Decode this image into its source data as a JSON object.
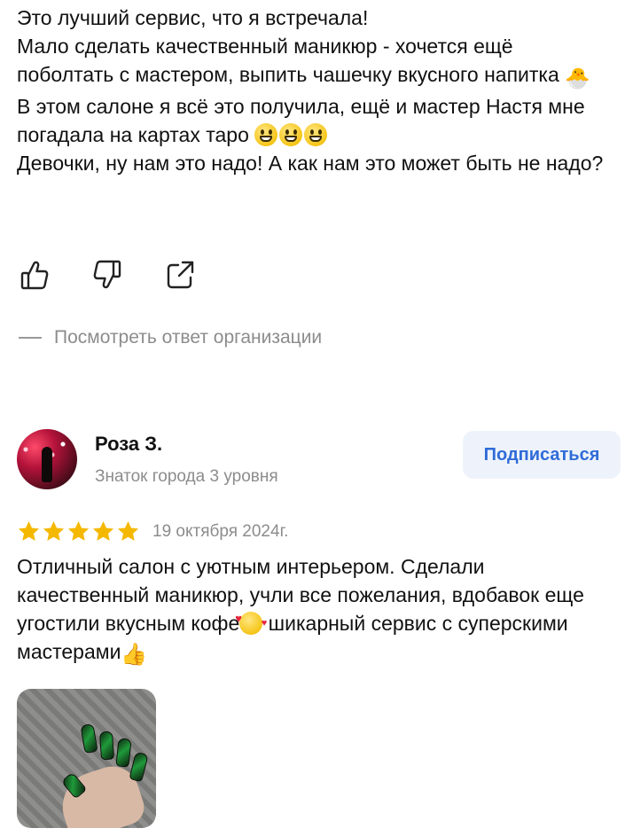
{
  "review1": {
    "lines": [
      "Это лучший сервис, что я встречала!",
      "Мало сделать качественный маникюр - хочется ещё поболтать с мастером, выпить чашечку вкусного напитка",
      "В этом салоне я всё это получила, ещё и мастер Настя мне погадала на картах таро",
      "Девочки, ну нам это надо! А как нам это может быть не надо?"
    ],
    "emoji_chick": "🐣",
    "actions": {
      "like_icon": "thumbs-up-icon",
      "dislike_icon": "thumbs-down-icon",
      "share_icon": "share-icon"
    },
    "org_answer_label": "Посмотреть ответ организации"
  },
  "review2": {
    "author_name": "Роза З.",
    "author_level": "Знаток города 3 уровня",
    "subscribe_label": "Подписаться",
    "rating": 5,
    "date": "19 октября 2024г.",
    "text_parts": [
      "Отличный салон с уютным интерьером. Сделали качественный маникюр, учли все пожелания, вдобавок еще угостили вкусным кофе",
      " шикарный сервис с суперскими мастерами"
    ],
    "photo_icon": "manicure-photo"
  },
  "colors": {
    "accent_blue": "#2f6bd8",
    "subscribe_bg": "#eef3fb",
    "star": "#f5b800",
    "muted_text": "#8c8c8c"
  }
}
